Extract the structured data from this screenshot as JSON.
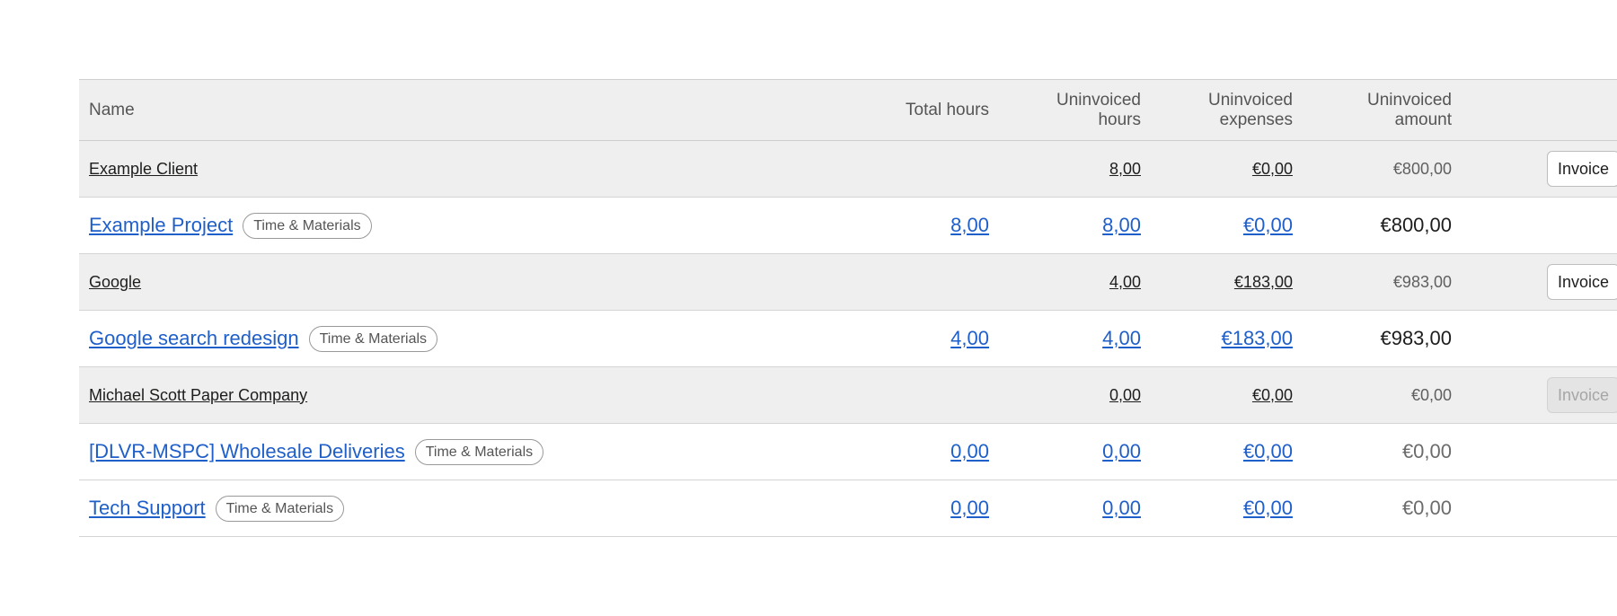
{
  "table": {
    "headers": {
      "name": "Name",
      "total_hours": "Total hours",
      "uninvoiced_hours_1": "Uninvoiced",
      "uninvoiced_hours_2": "hours",
      "uninvoiced_expenses_1": "Uninvoiced",
      "uninvoiced_expenses_2": "expenses",
      "uninvoiced_amount_1": "Uninvoiced",
      "uninvoiced_amount_2": "amount"
    },
    "rows": [
      {
        "type": "client",
        "name": "Example Client",
        "uninvoiced_hours": "8,00",
        "uninvoiced_expenses": "€0,00",
        "uninvoiced_amount": "€800,00",
        "action": "Invoice",
        "action_enabled": true
      },
      {
        "type": "project",
        "name": "Example Project",
        "badge": "Time & Materials",
        "total_hours": "8,00",
        "uninvoiced_hours": "8,00",
        "uninvoiced_expenses": "€0,00",
        "uninvoiced_amount": "€800,00"
      },
      {
        "type": "client",
        "name": "Google",
        "uninvoiced_hours": "4,00",
        "uninvoiced_expenses": "€183,00",
        "uninvoiced_amount": "€983,00",
        "action": "Invoice",
        "action_enabled": true
      },
      {
        "type": "project",
        "name": "Google search redesign",
        "badge": "Time & Materials",
        "total_hours": "4,00",
        "uninvoiced_hours": "4,00",
        "uninvoiced_expenses": "€183,00",
        "uninvoiced_amount": "€983,00"
      },
      {
        "type": "client",
        "name": "Michael Scott Paper Company",
        "uninvoiced_hours": "0,00",
        "uninvoiced_expenses": "€0,00",
        "uninvoiced_amount": "€0,00",
        "action": "Invoice",
        "action_enabled": false
      },
      {
        "type": "project",
        "name": "[DLVR-MSPC] Wholesale Deliveries",
        "badge": "Time & Materials",
        "total_hours": "0,00",
        "uninvoiced_hours": "0,00",
        "uninvoiced_expenses": "€0,00",
        "uninvoiced_amount": "€0,00"
      },
      {
        "type": "project",
        "name": "Tech Support",
        "badge": "Time & Materials",
        "total_hours": "0,00",
        "uninvoiced_hours": "0,00",
        "uninvoiced_expenses": "€0,00",
        "uninvoiced_amount": "€0,00"
      }
    ]
  },
  "colors": {
    "link": "#1f5fc9",
    "client_row_bg": "#efefef",
    "text": "#1d1e1c"
  }
}
